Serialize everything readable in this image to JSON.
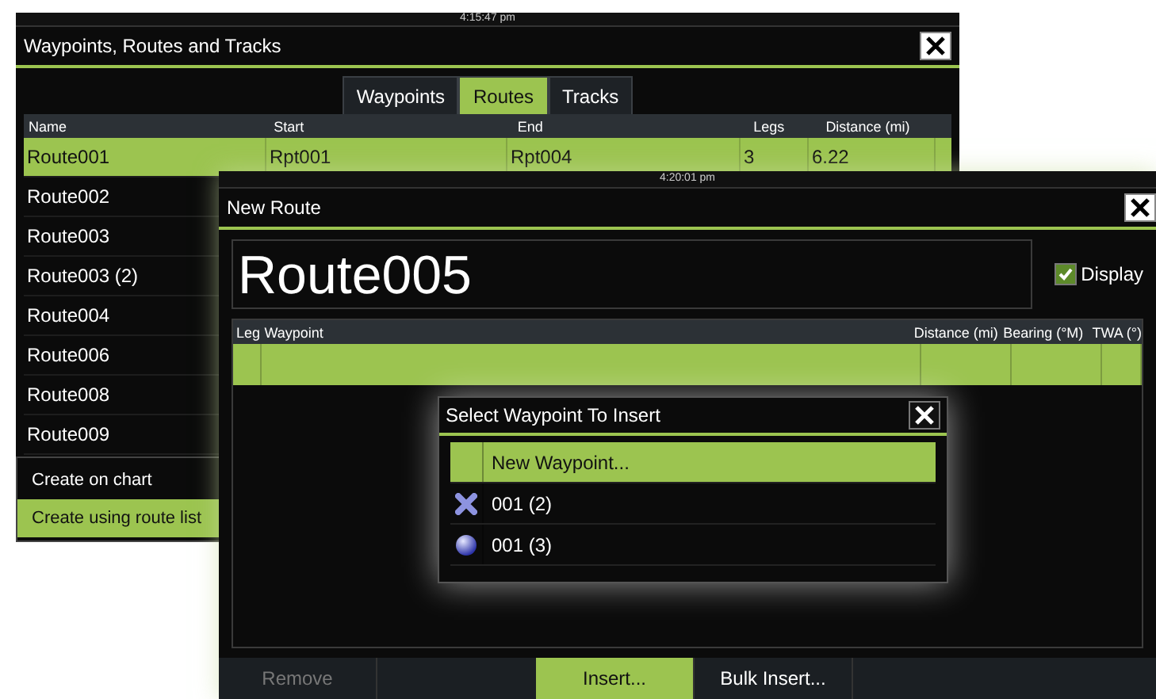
{
  "back_window": {
    "status_time": "4:15:47 pm",
    "title": "Waypoints, Routes and Tracks",
    "tabs": [
      {
        "label": "Waypoints",
        "selected": false
      },
      {
        "label": "Routes",
        "selected": true
      },
      {
        "label": "Tracks",
        "selected": false
      }
    ],
    "columns": [
      "Name",
      "Start",
      "End",
      "Legs",
      "Distance (mi)"
    ],
    "rows": [
      {
        "cells": [
          "Route001",
          "Rpt001",
          "Rpt004",
          "3",
          "6.22"
        ],
        "selected": true
      },
      {
        "cells": [
          "Route002"
        ],
        "selected": false
      },
      {
        "cells": [
          "Route003"
        ],
        "selected": false
      },
      {
        "cells": [
          "Route003 (2)"
        ],
        "selected": false
      },
      {
        "cells": [
          "Route004"
        ],
        "selected": false
      },
      {
        "cells": [
          "Route006"
        ],
        "selected": false
      },
      {
        "cells": [
          "Route008"
        ],
        "selected": false
      },
      {
        "cells": [
          "Route009"
        ],
        "selected": false
      }
    ],
    "menu": [
      {
        "label": "Create on chart",
        "selected": false
      },
      {
        "label": "Create using route list",
        "selected": true
      }
    ]
  },
  "new_route": {
    "status_time": "4:20:01 pm",
    "title": "New Route",
    "name_value": "Route005",
    "display": {
      "label": "Display",
      "checked": true
    },
    "columns": [
      "Leg",
      "Waypoint",
      "Distance (mi)",
      "Bearing (°M)",
      "TWA (°)"
    ],
    "rows": [
      {
        "selected": true
      }
    ],
    "buttons": [
      {
        "label": "Remove",
        "disabled": true,
        "selected": false
      },
      {
        "label": "Insert...",
        "disabled": false,
        "selected": true
      },
      {
        "label": "Bulk Insert...",
        "disabled": false,
        "selected": false
      }
    ]
  },
  "dialog": {
    "title": "Select Waypoint To Insert",
    "items": [
      {
        "kind": "action",
        "label": "New Waypoint...",
        "selected": true
      },
      {
        "kind": "cross",
        "label": "001 (2)",
        "selected": false
      },
      {
        "kind": "sphere",
        "label": "001 (3)",
        "selected": false
      }
    ]
  }
}
